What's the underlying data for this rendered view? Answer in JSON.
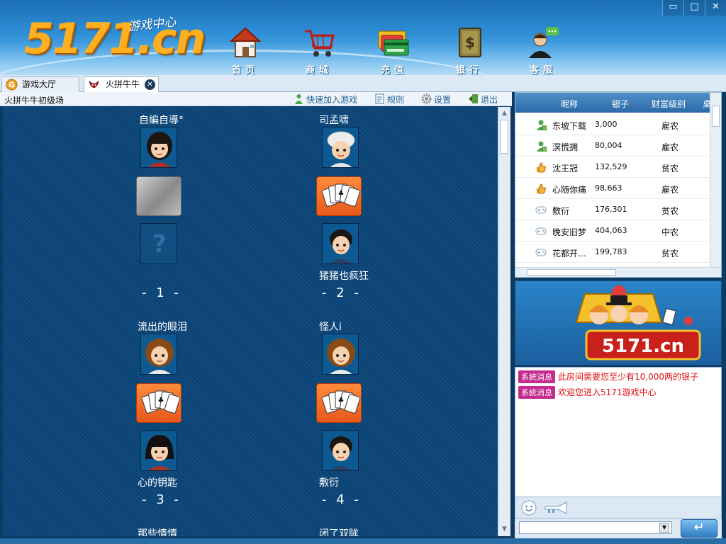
{
  "app": {
    "logo_text": "5171.cn",
    "logo_tagline": "游戏中心"
  },
  "nav": [
    {
      "label": "首页",
      "icon": "home-icon"
    },
    {
      "label": "商城",
      "icon": "shopping-cart-icon"
    },
    {
      "label": "充值",
      "icon": "recharge-cards-icon"
    },
    {
      "label": "银行",
      "icon": "bank-safe-icon"
    },
    {
      "label": "客服",
      "icon": "customer-service-icon"
    }
  ],
  "window_controls": {
    "minimize": "▭",
    "maximize": "□",
    "close": "✕"
  },
  "tabs": [
    {
      "label": "游戏大厅",
      "icon": "lobby-g-icon",
      "active": false
    },
    {
      "label": "火拼牛牛",
      "icon": "bull-game-icon",
      "active": true,
      "close": "✕"
    }
  ],
  "room": {
    "title": "火拼牛牛初级场",
    "tools": [
      {
        "label": "快速加入游戏",
        "icon": "quick-join-icon"
      },
      {
        "label": "规则",
        "icon": "rules-icon"
      },
      {
        "label": "设置",
        "icon": "settings-gear-icon"
      },
      {
        "label": "退出",
        "icon": "exit-icon"
      }
    ]
  },
  "tables": [
    {
      "number": "- 1 -",
      "state": "empty",
      "top_player": "自編自導°",
      "bottom_player": "",
      "bottom_unknown": true
    },
    {
      "number": "- 2 -",
      "state": "playing",
      "top_player": "司孟啸",
      "bottom_player": "猪猪也疯狂",
      "bottom_unknown": false
    },
    {
      "number": "- 3 -",
      "state": "playing",
      "top_player": "流出的眼泪",
      "bottom_player": "心的钥匙",
      "bottom_unknown": false
    },
    {
      "number": "- 4 -",
      "state": "playing",
      "top_player": "怪人i",
      "bottom_player": "敷衍",
      "bottom_unknown": false
    }
  ],
  "next_row_names": [
    "那些情情",
    "闭了双眸"
  ],
  "userlist": {
    "columns": [
      "昵称",
      "银子",
      "财富级别",
      "桌"
    ],
    "rows": [
      {
        "nick": "东坡下载",
        "silver": "3,000",
        "rank": "雇农",
        "icon": "player-seated-icon"
      },
      {
        "nick": "溟慌拥",
        "silver": "80,004",
        "rank": "雇农",
        "icon": "player-seated-icon"
      },
      {
        "nick": "沈王冠",
        "silver": "132,529",
        "rank": "贫农",
        "icon": "thumbs-up-icon"
      },
      {
        "nick": "心随你痛",
        "silver": "98,663",
        "rank": "雇农",
        "icon": "thumbs-up-icon"
      },
      {
        "nick": "敷衍",
        "silver": "176,301",
        "rank": "贫农",
        "icon": "gamepad-icon"
      },
      {
        "nick": "晚安旧梦",
        "silver": "404,063",
        "rank": "中农",
        "icon": "gamepad-icon"
      },
      {
        "nick": "花都开…",
        "silver": "199,783",
        "rank": "贫农",
        "icon": "gamepad-icon"
      }
    ]
  },
  "banner": {
    "logo_text": "5171.cn"
  },
  "chat": {
    "messages": [
      {
        "badge": "系統消息",
        "text": "此房间需要您至少有10,000两的银子"
      },
      {
        "badge": "系統消息",
        "text": "欢迎您进入5171游戏中心"
      }
    ],
    "input_value": "",
    "send_label": "↵"
  },
  "colors": {
    "header_blue": "#2f8fd6",
    "game_bg": "#0a4476",
    "table_active": "#e8581b",
    "system_badge": "#c62a8f",
    "system_text": "#dd1111"
  }
}
